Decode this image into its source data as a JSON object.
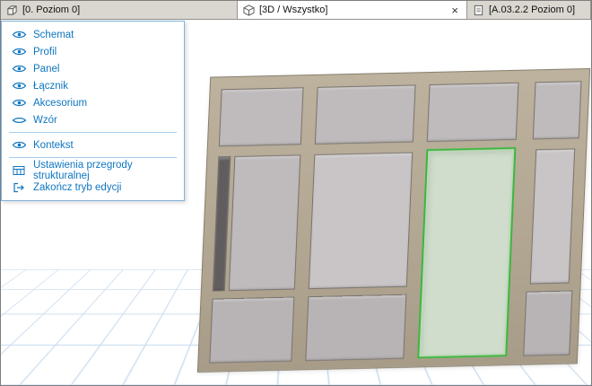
{
  "tabs": [
    {
      "label": "[0. Poziom 0]",
      "icon": "floor-plan-icon"
    },
    {
      "label": "[3D / Wszystko]",
      "icon": "3d-view-icon",
      "close": "×",
      "active": true
    },
    {
      "label": "[A.03.2.2 Poziom 0]",
      "icon": "section-icon"
    }
  ],
  "menu": {
    "items": [
      {
        "label": "Schemat",
        "icon": "eye-icon"
      },
      {
        "label": "Profil",
        "icon": "eye-icon"
      },
      {
        "label": "Panel",
        "icon": "eye-icon"
      },
      {
        "label": "Łącznik",
        "icon": "eye-icon"
      },
      {
        "label": "Akcesorium",
        "icon": "eye-icon"
      },
      {
        "label": "Wzór",
        "icon": "eye-closed-icon"
      }
    ],
    "context_item": {
      "label": "Kontekst",
      "icon": "eye-icon"
    },
    "actions": [
      {
        "label": "Ustawienia przegrody strukturalnej",
        "icon": "settings-grid-icon"
      },
      {
        "label": "Zakończ tryb edycji",
        "icon": "exit-icon"
      }
    ]
  },
  "colors": {
    "accent_blue": "#0f76c0",
    "selection_green": "#3fb53f",
    "mullion_tan": "#b2a793",
    "panel_gray": "#b8b4b6",
    "grid_blue": "#c7daee",
    "tab_bar_gray": "#d2cfc8"
  }
}
